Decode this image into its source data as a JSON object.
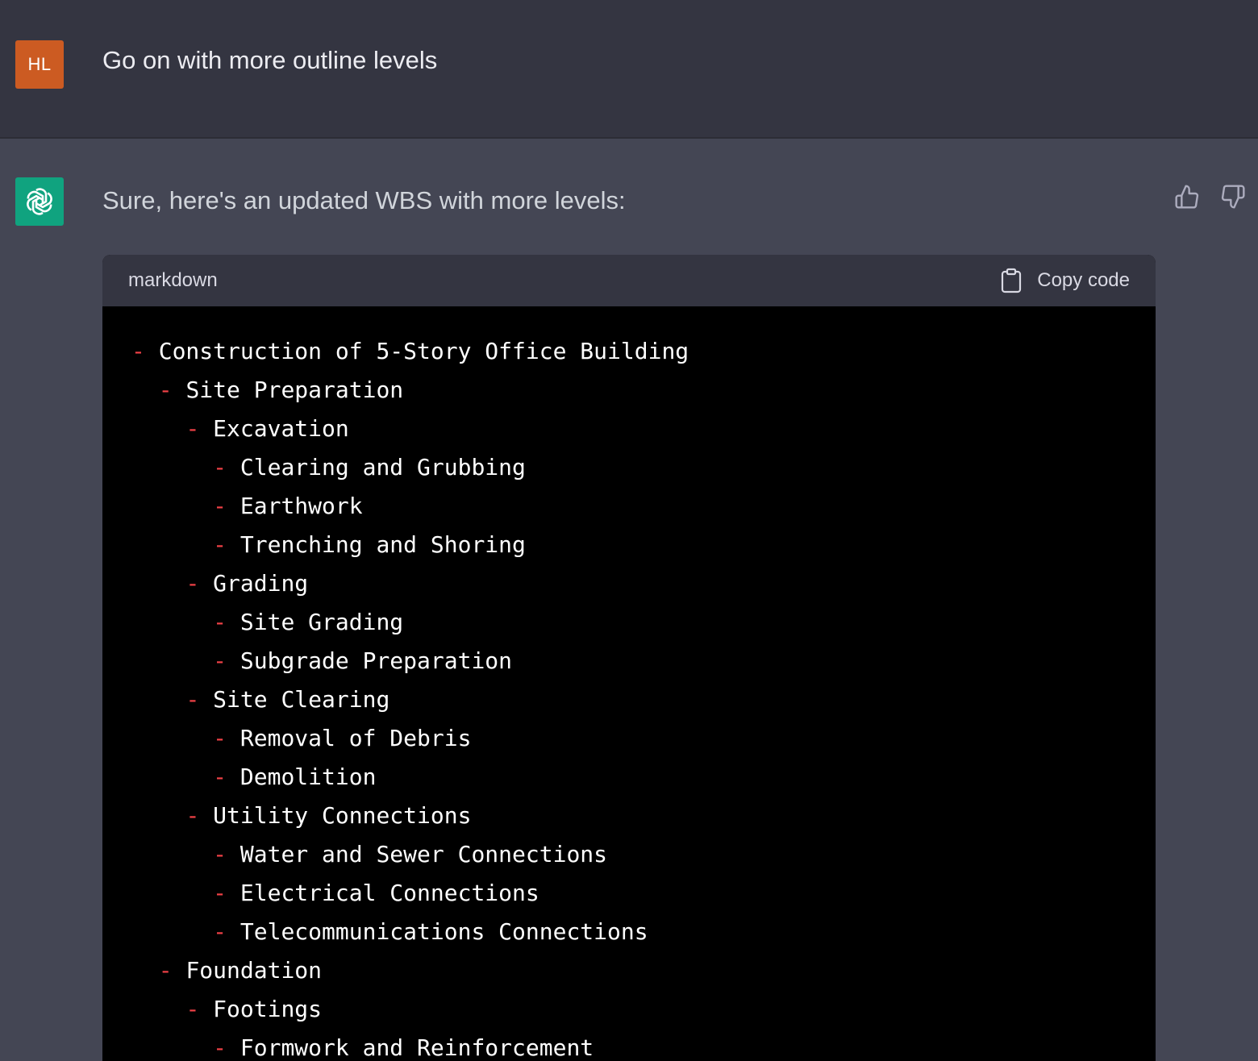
{
  "user_message": {
    "avatar_initials": "HL",
    "avatar_color": "#cc5b22",
    "text": "Go on with more outline levels"
  },
  "assistant_message": {
    "avatar_icon": "openai-logo-icon",
    "avatar_color": "#10a37f",
    "intro": "Sure, here's an updated WBS with more levels:",
    "feedback": {
      "thumbs_up_icon": "thumbs-up-icon",
      "thumbs_down_icon": "thumbs-down-icon"
    },
    "code_block": {
      "language": "markdown",
      "copy_label": "Copy code",
      "copy_icon": "clipboard-icon",
      "lines": [
        {
          "indent": 0,
          "marker": "-",
          "text": "Construction of 5-Story Office Building"
        },
        {
          "indent": 1,
          "marker": "-",
          "text": "Site Preparation"
        },
        {
          "indent": 2,
          "marker": "-",
          "text": "Excavation"
        },
        {
          "indent": 3,
          "marker": "-",
          "text": "Clearing and Grubbing"
        },
        {
          "indent": 3,
          "marker": "-",
          "text": "Earthwork"
        },
        {
          "indent": 3,
          "marker": "-",
          "text": "Trenching and Shoring"
        },
        {
          "indent": 2,
          "marker": "-",
          "text": "Grading"
        },
        {
          "indent": 3,
          "marker": "-",
          "text": "Site Grading"
        },
        {
          "indent": 3,
          "marker": "-",
          "text": "Subgrade Preparation"
        },
        {
          "indent": 2,
          "marker": "-",
          "text": "Site Clearing"
        },
        {
          "indent": 3,
          "marker": "-",
          "text": "Removal of Debris"
        },
        {
          "indent": 3,
          "marker": "-",
          "text": "Demolition"
        },
        {
          "indent": 2,
          "marker": "-",
          "text": "Utility Connections"
        },
        {
          "indent": 3,
          "marker": "-",
          "text": "Water and Sewer Connections"
        },
        {
          "indent": 3,
          "marker": "-",
          "text": "Electrical Connections"
        },
        {
          "indent": 3,
          "marker": "-",
          "text": "Telecommunications Connections"
        },
        {
          "indent": 1,
          "marker": "-",
          "text": "Foundation"
        },
        {
          "indent": 2,
          "marker": "-",
          "text": "Footings"
        },
        {
          "indent": 3,
          "marker": "-",
          "text": "Formwork and Reinforcement"
        }
      ]
    }
  },
  "colors": {
    "user_bg": "#343541",
    "assistant_bg": "#444654",
    "code_bg": "#000000",
    "bullet_red": "#ef4146"
  }
}
